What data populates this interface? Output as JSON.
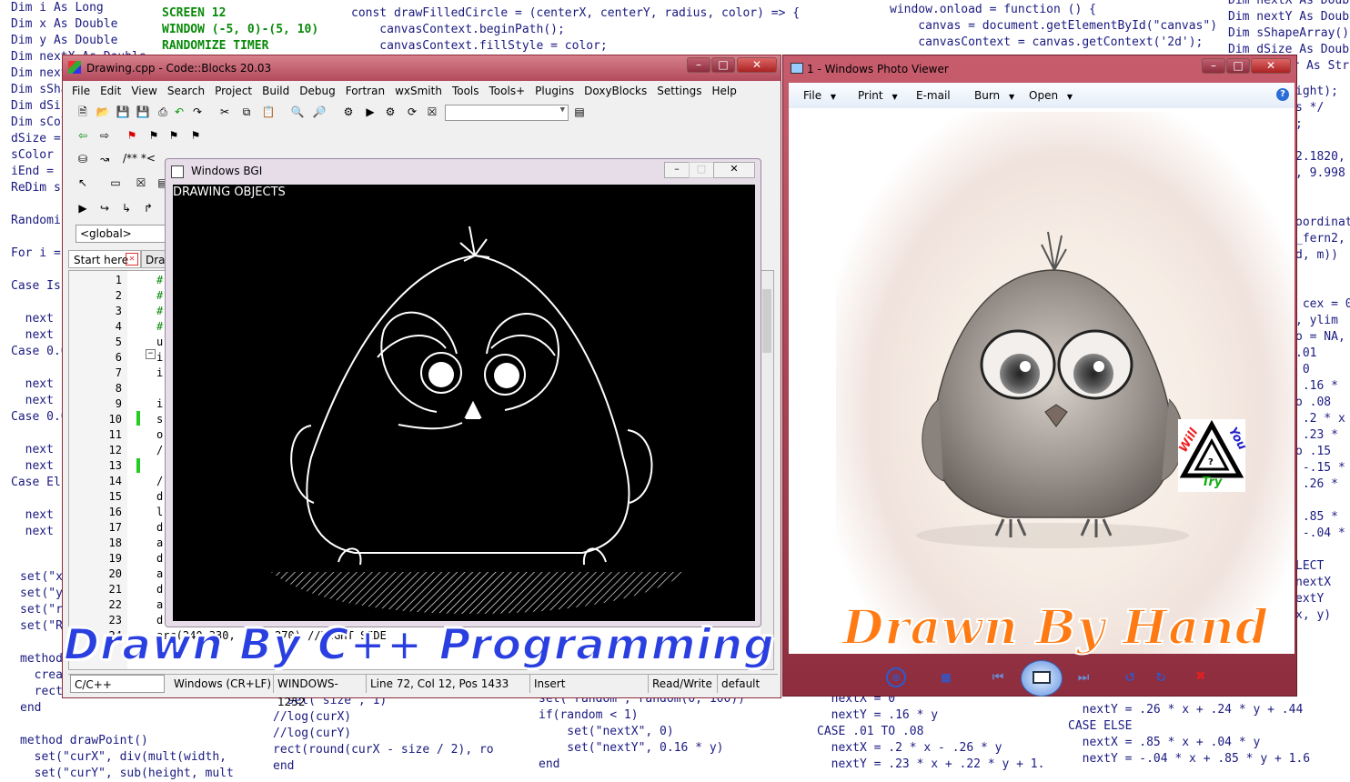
{
  "background_code": {
    "col1": [
      "Dim i As Long",
      "Dim x As Double",
      "Dim y As Double",
      "Dim nextX As Double",
      "Dim nextY As Double",
      "Dim sShape",
      "Dim dSize",
      "Dim sColor",
      "dSize =",
      "sColor",
      "iEnd =",
      "ReDim s",
      "",
      "Randomi",
      "",
      "For i =",
      "",
      "Case Is",
      "",
      "  next",
      "  next",
      "Case 0.0",
      "",
      "  next",
      "  next",
      "Case 0.0",
      "",
      "  next",
      "  next",
      "Case Els",
      "",
      "  next",
      "  next"
    ],
    "col1b": [
      "set(\"x",
      "set(\"y",
      "set(\"r",
      "set(\"R",
      "",
      "method",
      "  creat",
      "  rect",
      "end",
      "",
      "method drawPoint()",
      "  set(\"curX\", div(mult(width,",
      "  set(\"curY\", sub(height, mult"
    ],
    "col2": [
      "SCREEN 12",
      "WINDOW (-5, 0)-(5, 10)",
      "RANDOMIZE TIMER"
    ],
    "col2b": [
      "  set(\"size\", 1)",
      "//log(curX)",
      "//log(curY)",
      "rect(round(curX - size / 2), ro",
      "end"
    ],
    "col3": [
      "const drawFilledCircle = (centerX, centerY, radius, color) => {",
      "    canvasContext.beginPath();",
      "    canvasContext.fillStyle = color;"
    ],
    "col3b": [
      "set(\"random\", random(0, 100))",
      "if(random < 1)",
      "    set(\"nextX\", 0)",
      "    set(\"nextY\", 0.16 * y)",
      "end"
    ],
    "col4": [
      "window.onload = function () {",
      "    canvas = document.getElementById(\"canvas\")",
      "    canvasContext = canvas.getContext('2d');"
    ],
    "col4b": [
      "  nextX = 0",
      "  nextY = .16 * y",
      "CASE .01 TO .08",
      "  nextX = .2 * x - .26 * y",
      "  nextY = .23 * x + .22 * y + 1."
    ],
    "col5": [
      "Dim nextX As Doub",
      "Dim nextY As Double",
      "Dim sShapeArray()",
      "Dim dSize As Doub",
      "Dim sColor As Str"
    ],
    "col5mid": [
      "ight);",
      "s */",
      ";",
      "",
      "2.1820,",
      ", 9.998",
      "",
      "",
      "oordinat",
      "_fern2,",
      "d, m))",
      "",
      "",
      " cex = 0",
      ", ylim",
      "o = NA,",
      ".01",
      " 0",
      " .16 *",
      "o .08",
      " .2 * x",
      " .23 *",
      "o .15",
      " -.15 *",
      " .26 *",
      "",
      " .85 *",
      " -.04 *",
      "",
      "LECT",
      "nextX",
      "extY",
      "x, y)"
    ],
    "col5b": [
      "  nextY = .26 * x + .24 * y + .44",
      "CASE ELSE",
      "  nextX = .85 * x + .04 * y",
      "  nextY = -.04 * x + .85 * y + 1.6"
    ]
  },
  "codeblocks": {
    "title": "Drawing.cpp - Code::Blocks 20.03",
    "menu": [
      "File",
      "Edit",
      "View",
      "Search",
      "Project",
      "Build",
      "Debug",
      "Fortran",
      "wxSmith",
      "Tools",
      "Tools+",
      "Plugins",
      "DoxyBlocks",
      "Settings",
      "Help"
    ],
    "scope": "<global>",
    "tabs": [
      "Start here",
      "Draw"
    ],
    "line_numbers": [
      "1",
      "2",
      "3",
      "4",
      "5",
      "6",
      "7",
      "8",
      "9",
      "10",
      "11",
      "12",
      "13",
      "14",
      "15",
      "16",
      "17",
      "18",
      "19",
      "20",
      "21",
      "22",
      "23",
      "24"
    ],
    "code_prefix": [
      "#",
      "#",
      "#",
      "#",
      "u",
      "i",
      "i",
      "",
      "i",
      "s",
      "o",
      "/",
      "",
      "/",
      "d",
      "l",
      "d",
      "a",
      "d",
      "a",
      "d",
      "a",
      "d",
      "arc(240,330,  73, 270) //RIGHT SIDE"
    ],
    "status": [
      "C/C++",
      "Windows (CR+LF)",
      "WINDOWS-1252",
      "Line 72, Col 12, Pos 1433",
      "Insert",
      "Read/Write",
      "default"
    ],
    "doc_comment": "/** *<"
  },
  "bgi": {
    "title": "Windows BGI",
    "label": "DRAWING OBJECTS"
  },
  "photo_viewer": {
    "title": "1 - Windows Photo Viewer",
    "menu": [
      "File",
      "Print",
      "E-mail",
      "Burn",
      "Open"
    ],
    "logo": {
      "left": "Will",
      "right": "You",
      "bottom": "Try"
    }
  },
  "overlays": {
    "cpp": "Drawn By C++ Programming",
    "hand": "Drawn By Hand"
  },
  "colors": {
    "title_bar": "#c95a6a",
    "title_bar_dark": "#8f2f40",
    "overlay_blue": "#2a3fe0",
    "overlay_orange": "#ff7a12"
  }
}
